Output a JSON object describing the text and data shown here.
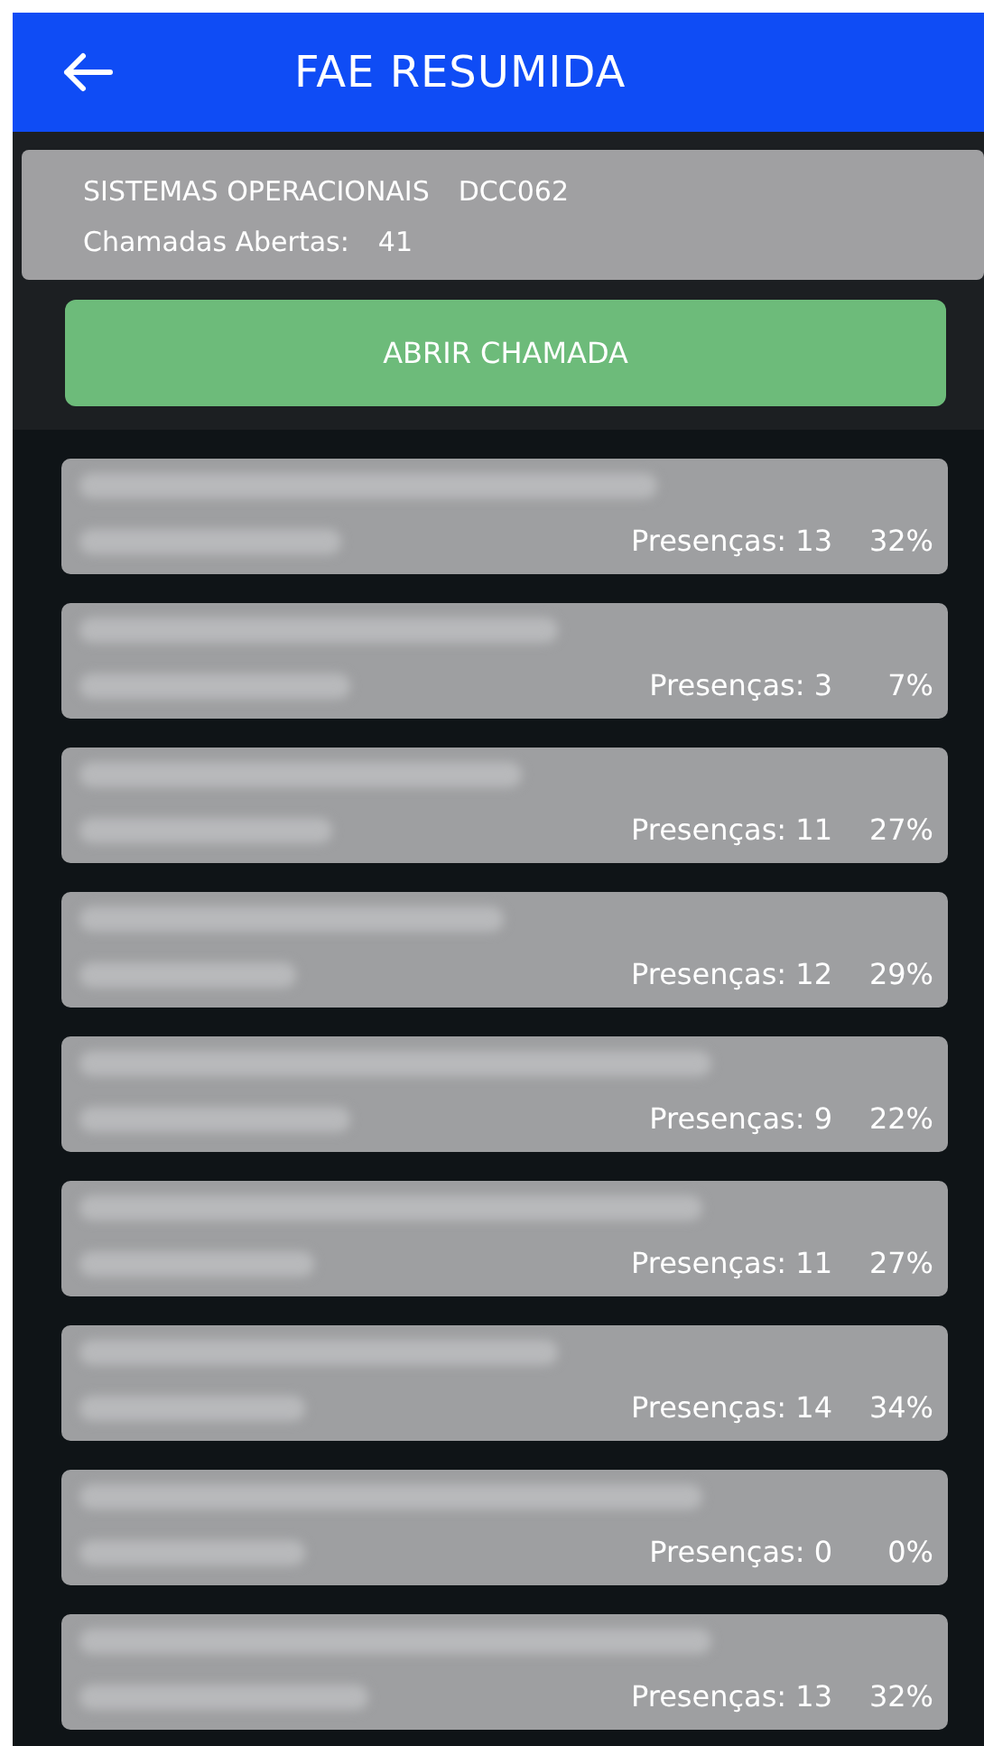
{
  "header": {
    "title": "FAE RESUMIDA"
  },
  "course": {
    "name": "SISTEMAS OPERACIONAIS",
    "code": "DCC062",
    "open_calls_label": "Chamadas Abertas:",
    "open_calls": "41"
  },
  "action_button": "ABRIR CHAMADA",
  "students": [
    {
      "presences": "Presenças: 13",
      "percent": "32%"
    },
    {
      "presences": "Presenças: 3",
      "percent": "7%"
    },
    {
      "presences": "Presenças: 11",
      "percent": "27%"
    },
    {
      "presences": "Presenças: 12",
      "percent": "29%"
    },
    {
      "presences": "Presenças: 9",
      "percent": "22%"
    },
    {
      "presences": "Presenças: 11",
      "percent": "27%"
    },
    {
      "presences": "Presenças: 14",
      "percent": "34%"
    },
    {
      "presences": "Presenças: 0",
      "percent": "0%"
    },
    {
      "presences": "Presenças: 13",
      "percent": "32%"
    }
  ]
}
